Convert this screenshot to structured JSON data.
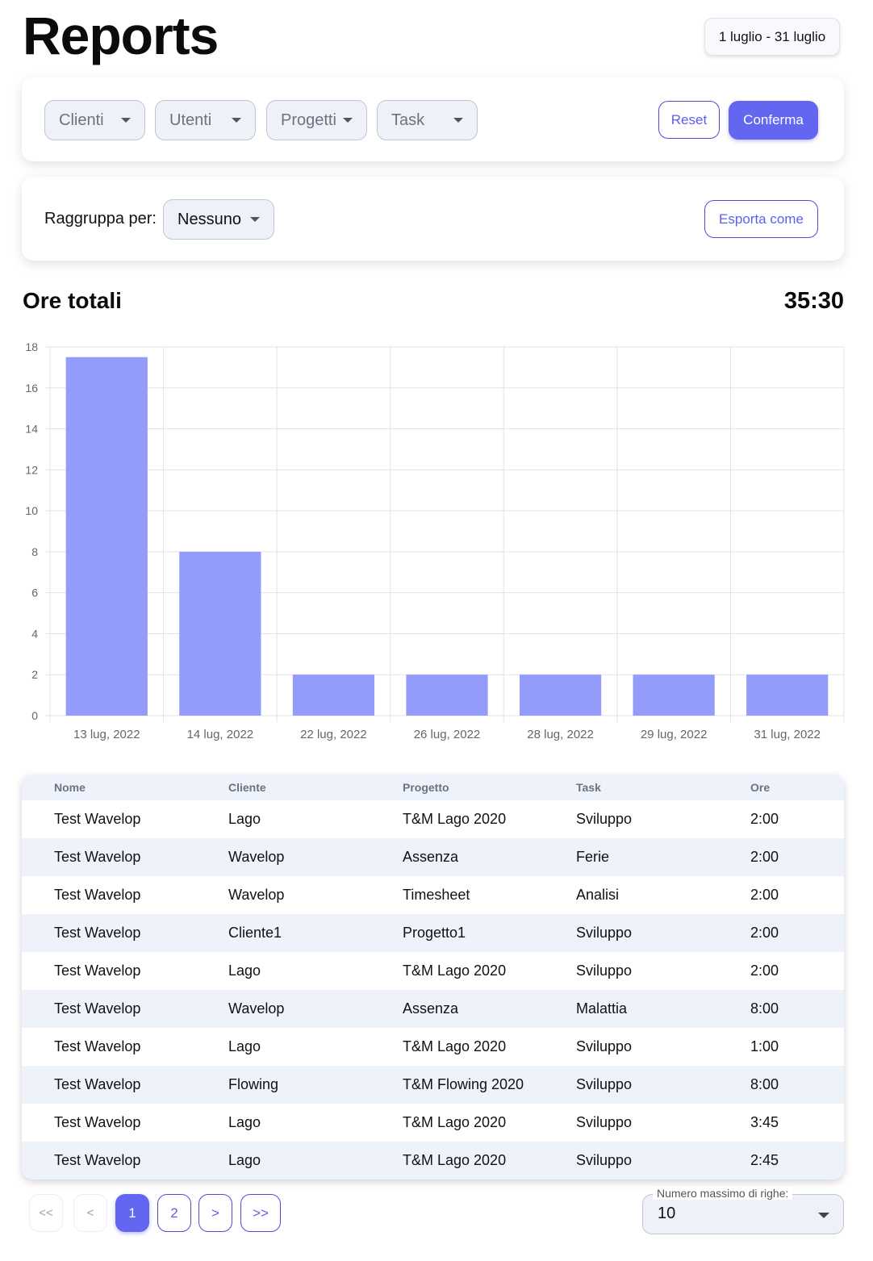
{
  "header": {
    "title": "Reports",
    "date_range": "1 luglio - 31 luglio"
  },
  "filters": {
    "clients": "Clienti",
    "users": "Utenti",
    "projects": "Progetti",
    "task": "Task",
    "reset_label": "Reset",
    "confirm_label": "Conferma"
  },
  "grouping": {
    "label": "Raggruppa per:",
    "value": "Nessuno",
    "export_label": "Esporta come"
  },
  "summary": {
    "title": "Ore totali",
    "total": "35:30"
  },
  "chart_data": {
    "type": "bar",
    "categories": [
      "13 lug, 2022",
      "14 lug, 2022",
      "22 lug, 2022",
      "26 lug, 2022",
      "28 lug, 2022",
      "29 lug, 2022",
      "31 lug, 2022"
    ],
    "values": [
      17.5,
      8,
      2,
      2,
      2,
      2,
      2
    ],
    "ylim": [
      0,
      18
    ],
    "yticks": [
      0,
      2,
      4,
      6,
      8,
      10,
      12,
      14,
      16,
      18
    ],
    "grid": true,
    "bar_color": "#939bfb"
  },
  "table": {
    "headers": [
      "Nome",
      "Cliente",
      "Progetto",
      "Task",
      "Ore"
    ],
    "rows": [
      [
        "Test Wavelop",
        "Lago",
        "T&M Lago 2020",
        "Sviluppo",
        "2:00"
      ],
      [
        "Test Wavelop",
        "Wavelop",
        "Assenza",
        "Ferie",
        "2:00"
      ],
      [
        "Test Wavelop",
        "Wavelop",
        "Timesheet",
        "Analisi",
        "2:00"
      ],
      [
        "Test Wavelop",
        "Cliente1",
        "Progetto1",
        "Sviluppo",
        "2:00"
      ],
      [
        "Test Wavelop",
        "Lago",
        "T&M Lago 2020",
        "Sviluppo",
        "2:00"
      ],
      [
        "Test Wavelop",
        "Wavelop",
        "Assenza",
        "Malattia",
        "8:00"
      ],
      [
        "Test Wavelop",
        "Lago",
        "T&M Lago 2020",
        "Sviluppo",
        "1:00"
      ],
      [
        "Test Wavelop",
        "Flowing",
        "T&M Flowing 2020",
        "Sviluppo",
        "8:00"
      ],
      [
        "Test Wavelop",
        "Lago",
        "T&M Lago 2020",
        "Sviluppo",
        "3:45"
      ],
      [
        "Test Wavelop",
        "Lago",
        "T&M Lago 2020",
        "Sviluppo",
        "2:45"
      ]
    ]
  },
  "pagination": {
    "first": "<<",
    "prev": "<",
    "pages": [
      "1",
      "2"
    ],
    "current_page": "1",
    "next": ">",
    "last": ">>",
    "rows_label": "Numero massimo di righe:",
    "rows_value": "10"
  },
  "colors": {
    "accent": "#6366f1",
    "outline": "#6a3fd8",
    "bar": "#939bfb"
  }
}
